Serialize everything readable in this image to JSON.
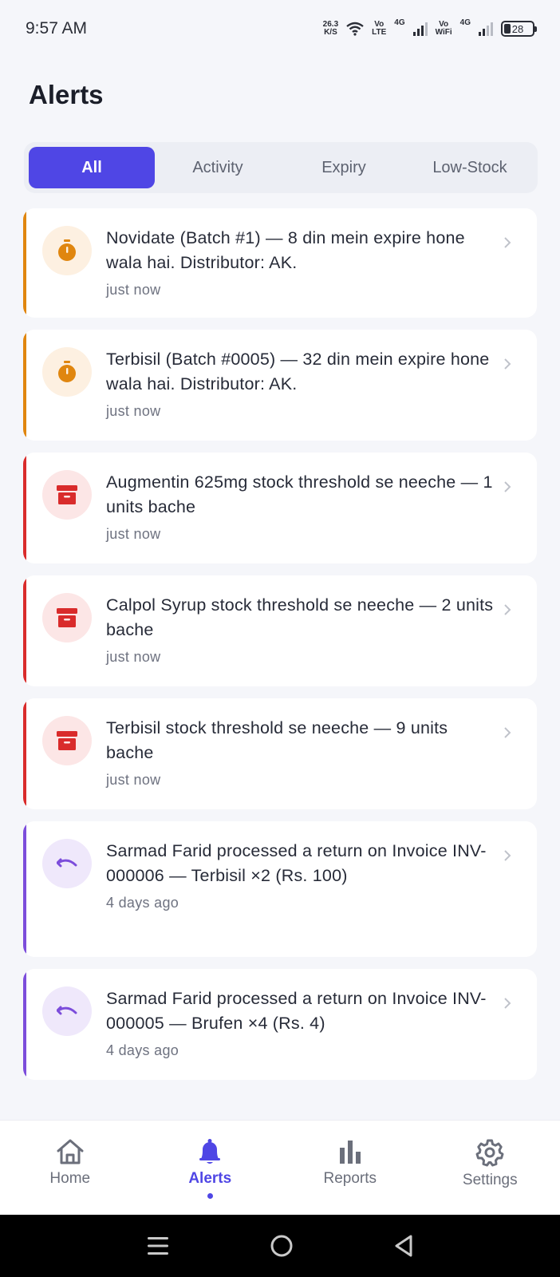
{
  "status_bar": {
    "time": "9:57 AM",
    "net_speed_value": "26.3",
    "net_speed_unit": "K/S",
    "volte_top": "Vo",
    "volte_bottom": "LTE",
    "sig1_label": "4G",
    "vowifi_top": "Vo",
    "vowifi_bottom": "WiFi",
    "sig2_label": "4G",
    "battery": "28"
  },
  "page": {
    "title": "Alerts"
  },
  "tabs": [
    {
      "label": "All",
      "active": true
    },
    {
      "label": "Activity",
      "active": false
    },
    {
      "label": "Expiry",
      "active": false
    },
    {
      "label": "Low-Stock",
      "active": false
    }
  ],
  "colors": {
    "expiry_accent": "#e0860f",
    "lowstock_accent": "#d92b2b",
    "activity_accent": "#7c4ddb",
    "primary": "#4f46e5"
  },
  "alerts": [
    {
      "type": "expiry",
      "icon": "timer-icon",
      "text": "Novidate (Batch #1) — 8 din mein expire hone wala hai. Distributor: AK.",
      "time": "just now"
    },
    {
      "type": "expiry",
      "icon": "timer-icon",
      "text": "Terbisil (Batch #0005) — 32 din mein expire hone wala hai. Distributor: AK.",
      "time": "just now"
    },
    {
      "type": "lowstock",
      "icon": "archive-box-icon",
      "text": "Augmentin 625mg stock threshold se neeche — 1 units bache",
      "time": "just now"
    },
    {
      "type": "lowstock",
      "icon": "archive-box-icon",
      "text": "Calpol Syrup stock threshold se neeche — 2 units bache",
      "time": "just now"
    },
    {
      "type": "lowstock",
      "icon": "archive-box-icon",
      "text": "Terbisil stock threshold se neeche — 9 units bache",
      "time": "just now"
    },
    {
      "type": "activity",
      "icon": "undo-return-icon",
      "text": "Sarmad Farid processed a return on Invoice INV-000006 — Terbisil ×2 (Rs. 100)",
      "time": "4 days ago"
    },
    {
      "type": "activity",
      "icon": "undo-return-icon",
      "text": "Sarmad Farid processed a return on Invoice INV-000005 — Brufen ×4 (Rs. 4)",
      "time": "4 days ago"
    }
  ],
  "bottom_nav": [
    {
      "label": "Home",
      "icon": "home-icon",
      "active": false
    },
    {
      "label": "Alerts",
      "icon": "bell-icon",
      "active": true
    },
    {
      "label": "Reports",
      "icon": "bar-chart-icon",
      "active": false
    },
    {
      "label": "Settings",
      "icon": "gear-icon",
      "active": false
    }
  ]
}
